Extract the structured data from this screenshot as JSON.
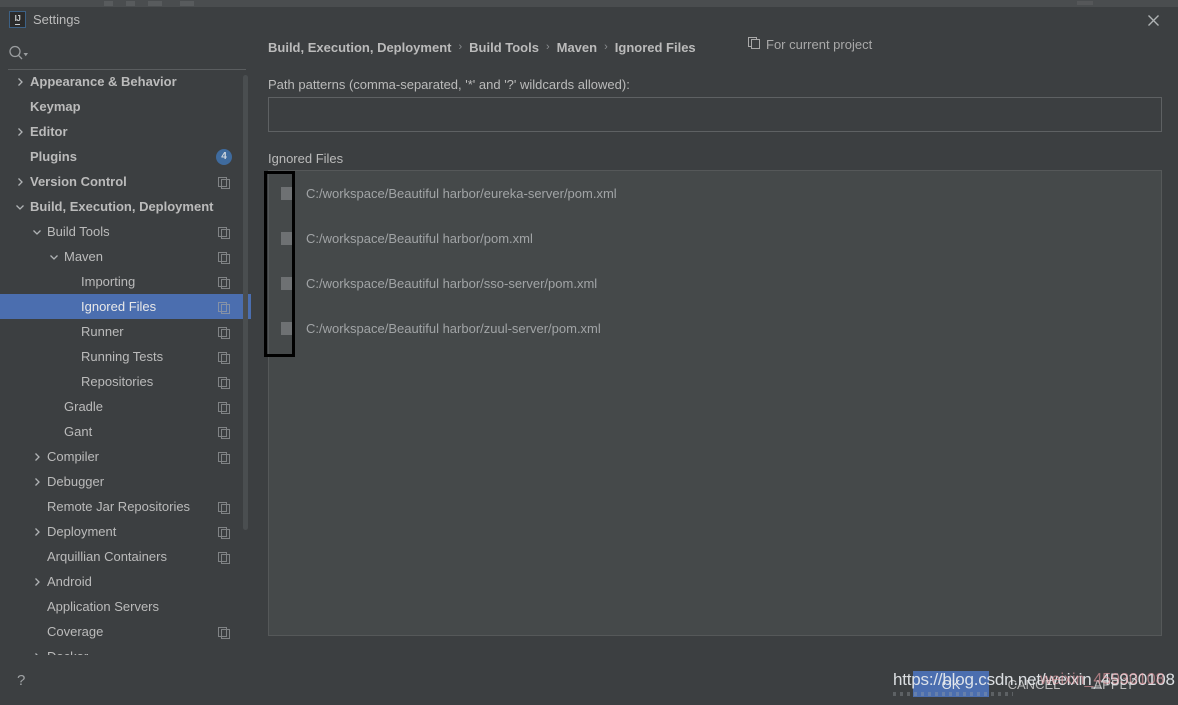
{
  "window": {
    "title": "Settings",
    "app_icon": "intellij-idea-icon",
    "close_icon": "close-icon"
  },
  "search": {
    "placeholder": "",
    "value": "",
    "icon": "search-icon",
    "dropdown_icon": "chevron-down-icon"
  },
  "sidebar": {
    "items": [
      {
        "label": "Appearance & Behavior",
        "indent": 0,
        "arrow": "chevron-right-icon",
        "bold": true,
        "copy": false,
        "badge": null,
        "selected": false
      },
      {
        "label": "Keymap",
        "indent": 0,
        "arrow": null,
        "bold": true,
        "copy": false,
        "badge": null,
        "selected": false
      },
      {
        "label": "Editor",
        "indent": 0,
        "arrow": "chevron-right-icon",
        "bold": true,
        "copy": false,
        "badge": null,
        "selected": false
      },
      {
        "label": "Plugins",
        "indent": 0,
        "arrow": null,
        "bold": true,
        "copy": false,
        "badge": "4",
        "selected": false
      },
      {
        "label": "Version Control",
        "indent": 0,
        "arrow": "chevron-right-icon",
        "bold": true,
        "copy": true,
        "badge": null,
        "selected": false
      },
      {
        "label": "Build, Execution, Deployment",
        "indent": 0,
        "arrow": "chevron-down-icon",
        "bold": true,
        "copy": false,
        "badge": null,
        "selected": false
      },
      {
        "label": "Build Tools",
        "indent": 1,
        "arrow": "chevron-down-icon",
        "bold": false,
        "copy": true,
        "badge": null,
        "selected": false
      },
      {
        "label": "Maven",
        "indent": 2,
        "arrow": "chevron-down-icon",
        "bold": false,
        "copy": true,
        "badge": null,
        "selected": false
      },
      {
        "label": "Importing",
        "indent": 3,
        "arrow": null,
        "bold": false,
        "copy": true,
        "badge": null,
        "selected": false
      },
      {
        "label": "Ignored Files",
        "indent": 3,
        "arrow": null,
        "bold": false,
        "copy": true,
        "badge": null,
        "selected": true
      },
      {
        "label": "Runner",
        "indent": 3,
        "arrow": null,
        "bold": false,
        "copy": true,
        "badge": null,
        "selected": false
      },
      {
        "label": "Running Tests",
        "indent": 3,
        "arrow": null,
        "bold": false,
        "copy": true,
        "badge": null,
        "selected": false
      },
      {
        "label": "Repositories",
        "indent": 3,
        "arrow": null,
        "bold": false,
        "copy": true,
        "badge": null,
        "selected": false
      },
      {
        "label": "Gradle",
        "indent": 2,
        "arrow": null,
        "bold": false,
        "copy": true,
        "badge": null,
        "selected": false
      },
      {
        "label": "Gant",
        "indent": 2,
        "arrow": null,
        "bold": false,
        "copy": true,
        "badge": null,
        "selected": false
      },
      {
        "label": "Compiler",
        "indent": 1,
        "arrow": "chevron-right-icon",
        "bold": false,
        "copy": true,
        "badge": null,
        "selected": false
      },
      {
        "label": "Debugger",
        "indent": 1,
        "arrow": "chevron-right-icon",
        "bold": false,
        "copy": false,
        "badge": null,
        "selected": false
      },
      {
        "label": "Remote Jar Repositories",
        "indent": 1,
        "arrow": null,
        "bold": false,
        "copy": true,
        "badge": null,
        "selected": false
      },
      {
        "label": "Deployment",
        "indent": 1,
        "arrow": "chevron-right-icon",
        "bold": false,
        "copy": true,
        "badge": null,
        "selected": false
      },
      {
        "label": "Arquillian Containers",
        "indent": 1,
        "arrow": null,
        "bold": false,
        "copy": true,
        "badge": null,
        "selected": false
      },
      {
        "label": "Android",
        "indent": 1,
        "arrow": "chevron-right-icon",
        "bold": false,
        "copy": false,
        "badge": null,
        "selected": false
      },
      {
        "label": "Application Servers",
        "indent": 1,
        "arrow": null,
        "bold": false,
        "copy": false,
        "badge": null,
        "selected": false
      },
      {
        "label": "Coverage",
        "indent": 1,
        "arrow": null,
        "bold": false,
        "copy": true,
        "badge": null,
        "selected": false
      },
      {
        "label": "Docker",
        "indent": 1,
        "arrow": "chevron-right-icon",
        "bold": false,
        "copy": false,
        "badge": null,
        "selected": false
      }
    ]
  },
  "breadcrumb": {
    "crumbs": [
      "Build, Execution, Deployment",
      "Build Tools",
      "Maven",
      "Ignored Files"
    ],
    "separator": "›",
    "scope_label": "For current project",
    "scope_icon": "copy-icon"
  },
  "main": {
    "path_patterns_label": "Path patterns (comma-separated, '*' and '?' wildcards allowed):",
    "path_patterns_value": "",
    "path_patterns_placeholder": "",
    "ignored_files_label": "Ignored Files",
    "files": [
      {
        "path": "C:/workspace/Beautiful harbor/eureka-server/pom.xml",
        "checked": false
      },
      {
        "path": "C:/workspace/Beautiful harbor/pom.xml",
        "checked": false
      },
      {
        "path": "C:/workspace/Beautiful harbor/sso-server/pom.xml",
        "checked": false
      },
      {
        "path": "C:/workspace/Beautiful harbor/zuul-server/pom.xml",
        "checked": false
      }
    ]
  },
  "footer": {
    "help_label": "?",
    "ok_label": "OK",
    "cancel_label": "CANCEL",
    "apply_label": "APPLY"
  },
  "watermark": {
    "text": "https://blog.csdn.net/weixin_45930108",
    "overlay_text": "weixin_45930108"
  },
  "colors": {
    "background": "#3c3f41",
    "selection": "#4b6eaf",
    "text": "#bbbbbb",
    "muted_text": "#a1a4a6",
    "list_background": "#45494a",
    "border": "#5e6163",
    "annotation": "#000000",
    "badge": "#3f6b9e"
  }
}
